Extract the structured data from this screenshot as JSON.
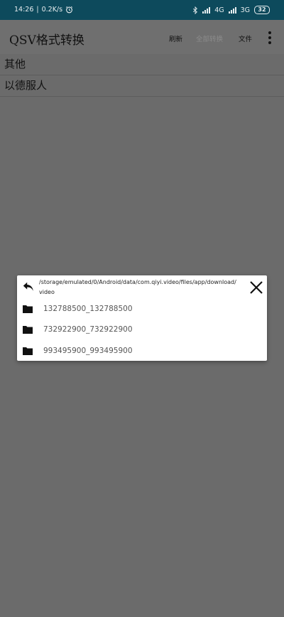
{
  "status_bar": {
    "time": "14:26",
    "speed": "0.2K/s",
    "network_4g": "4G",
    "network_3g": "3G",
    "battery": "32"
  },
  "app_bar": {
    "title": "QSV格式转换",
    "refresh": "刷新",
    "convert_all": "全部转换",
    "files": "文件"
  },
  "list": {
    "items": [
      {
        "label": "其他"
      },
      {
        "label": "以德服人"
      }
    ]
  },
  "dialog": {
    "path": "/storage/emulated/0/Android/data/com.qiyi.video/files/app/download/video",
    "folders": [
      {
        "name": "132788500_132788500"
      },
      {
        "name": "732922900_732922900"
      },
      {
        "name": "993495900_993495900"
      }
    ]
  },
  "colors": {
    "status_bar_bg": "#0d4a5c",
    "overlay_bg": "#6b6b6b",
    "dialog_bg": "#ffffff"
  }
}
